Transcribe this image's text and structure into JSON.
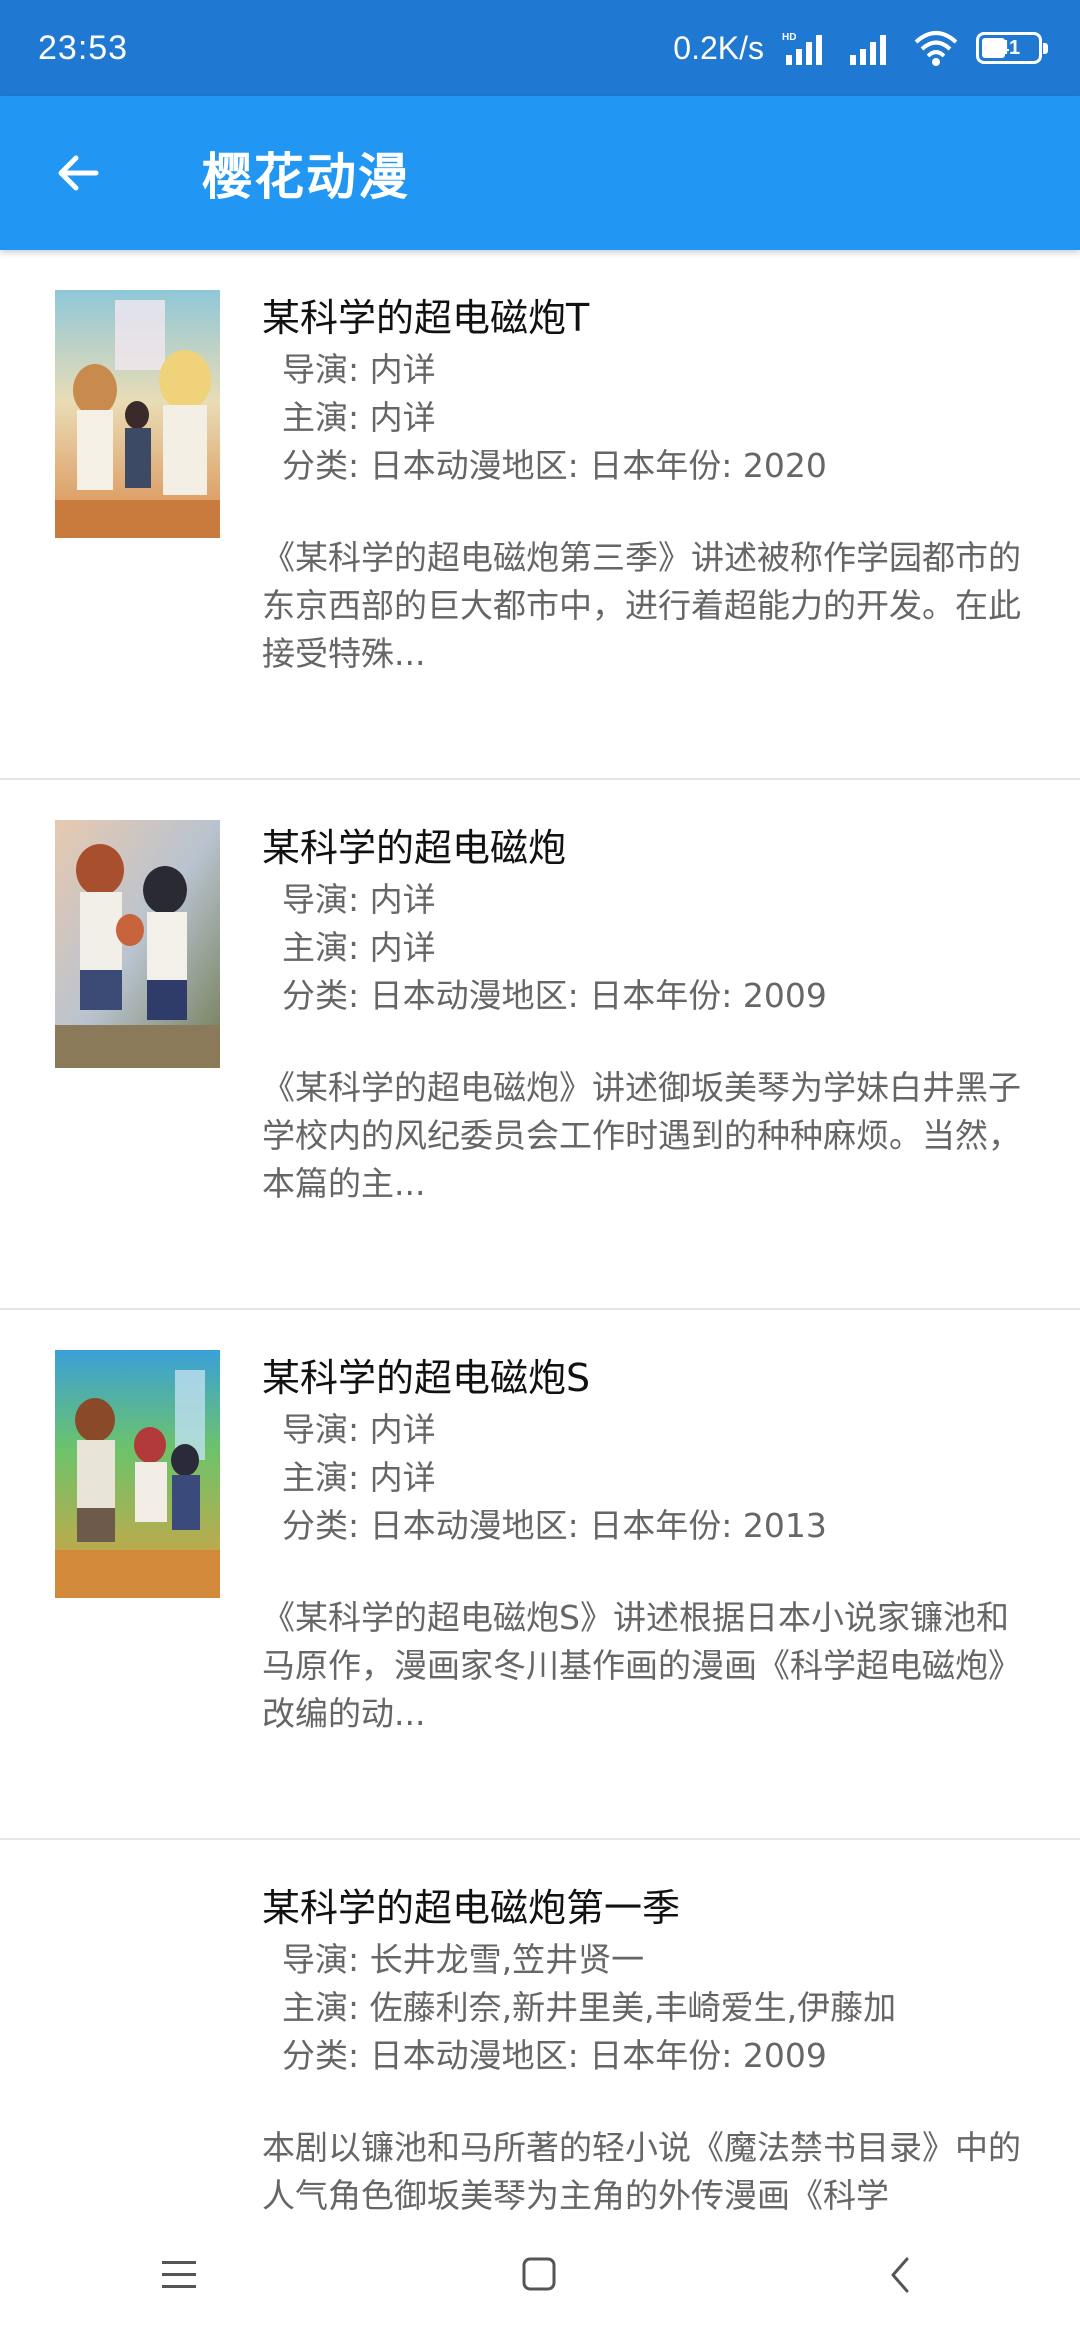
{
  "status_bar": {
    "time": "23:53",
    "network_speed": "0.2K/s",
    "hd_label": "HD",
    "battery_level": "41"
  },
  "app_bar": {
    "title": "樱花动漫"
  },
  "items": [
    {
      "title": "某科学的超电磁炮T",
      "director_label": "导演:",
      "director": "内详",
      "cast_label": "主演:",
      "cast": "内详",
      "category_label": "分类:",
      "category": "日本动漫地区: 日本年份: 2020",
      "description": "《某科学的超电磁炮第三季》讲述被称作学园都市的东京西部的巨大都市中，进行着超能力的开发。在此接受特殊..."
    },
    {
      "title": "某科学的超电磁炮",
      "director_label": "导演:",
      "director": "内详",
      "cast_label": "主演:",
      "cast": "内详",
      "category_label": "分类:",
      "category": "日本动漫地区: 日本年份: 2009",
      "description": "《某科学的超电磁炮》讲述御坂美琴为学妹白井黑子学校内的风纪委员会工作时遇到的种种麻烦。当然，本篇的主..."
    },
    {
      "title": "某科学的超电磁炮S",
      "director_label": "导演:",
      "director": "内详",
      "cast_label": "主演:",
      "cast": "内详",
      "category_label": "分类:",
      "category": "日本动漫地区: 日本年份: 2013",
      "description": "《某科学的超电磁炮S》讲述根据日本小说家镰池和马原作，漫画家冬川基作画的漫画《科学超电磁炮》改编的动..."
    },
    {
      "title": "某科学的超电磁炮第一季",
      "director_label": "导演:",
      "director": "长井龙雪,笠井贤一",
      "cast_label": "主演:",
      "cast": "佐藤利奈,新井里美,丰崎爱生,伊藤加",
      "category_label": "分类:",
      "category": "日本动漫地区: 日本年份: 2009",
      "description": "本剧以镰池和马所著的轻小说《魔法禁书目录》中的人气角色御坂美琴为主角的外传漫画《科学"
    }
  ],
  "colors": {
    "status_bar": "#1f78d1",
    "app_bar": "#2196f3"
  },
  "icons": {
    "back": "arrow-left-icon",
    "menu": "menu-icon",
    "home": "square-home-icon",
    "nav_back": "chevron-left-icon"
  }
}
